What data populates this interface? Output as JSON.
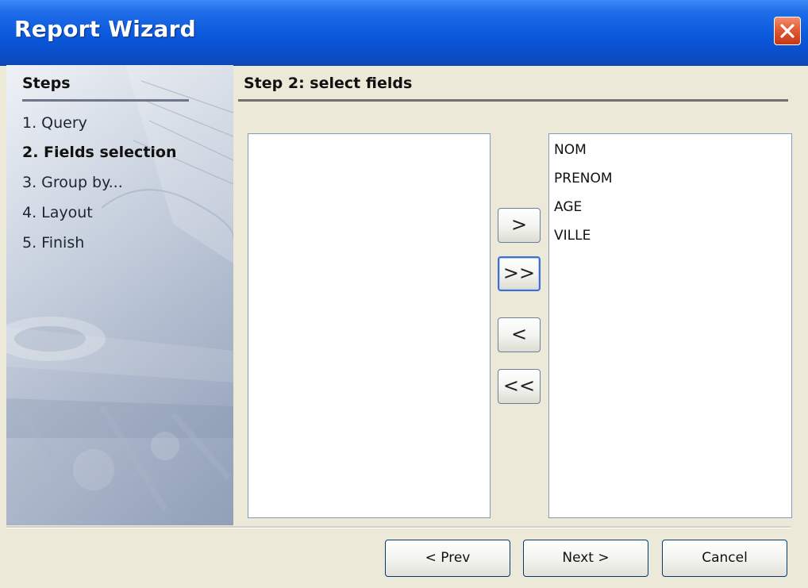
{
  "window": {
    "title": "Report Wizard"
  },
  "steps": {
    "heading": "Steps",
    "items": [
      {
        "label": "1. Query",
        "current": false
      },
      {
        "label": "2. Fields selection",
        "current": true
      },
      {
        "label": "3. Group by...",
        "current": false
      },
      {
        "label": "4. Layout",
        "current": false
      },
      {
        "label": "5. Finish",
        "current": false
      }
    ]
  },
  "content": {
    "title": "Step 2: select fields",
    "available_fields": [],
    "selected_fields": [
      "NOM",
      "PRENOM",
      "AGE",
      "VILLE"
    ],
    "buttons": {
      "add": ">",
      "add_all": ">>",
      "remove": "<",
      "remove_all": "<<"
    }
  },
  "footer": {
    "prev": "< Prev",
    "next": "Next >",
    "cancel": "Cancel"
  },
  "colors": {
    "titlebar": "#0b58dc",
    "close_button": "#e2572f",
    "dialog_bg": "#ece9d8",
    "focus_border": "#3f6fd1"
  },
  "icons": {
    "close": "close-icon"
  }
}
